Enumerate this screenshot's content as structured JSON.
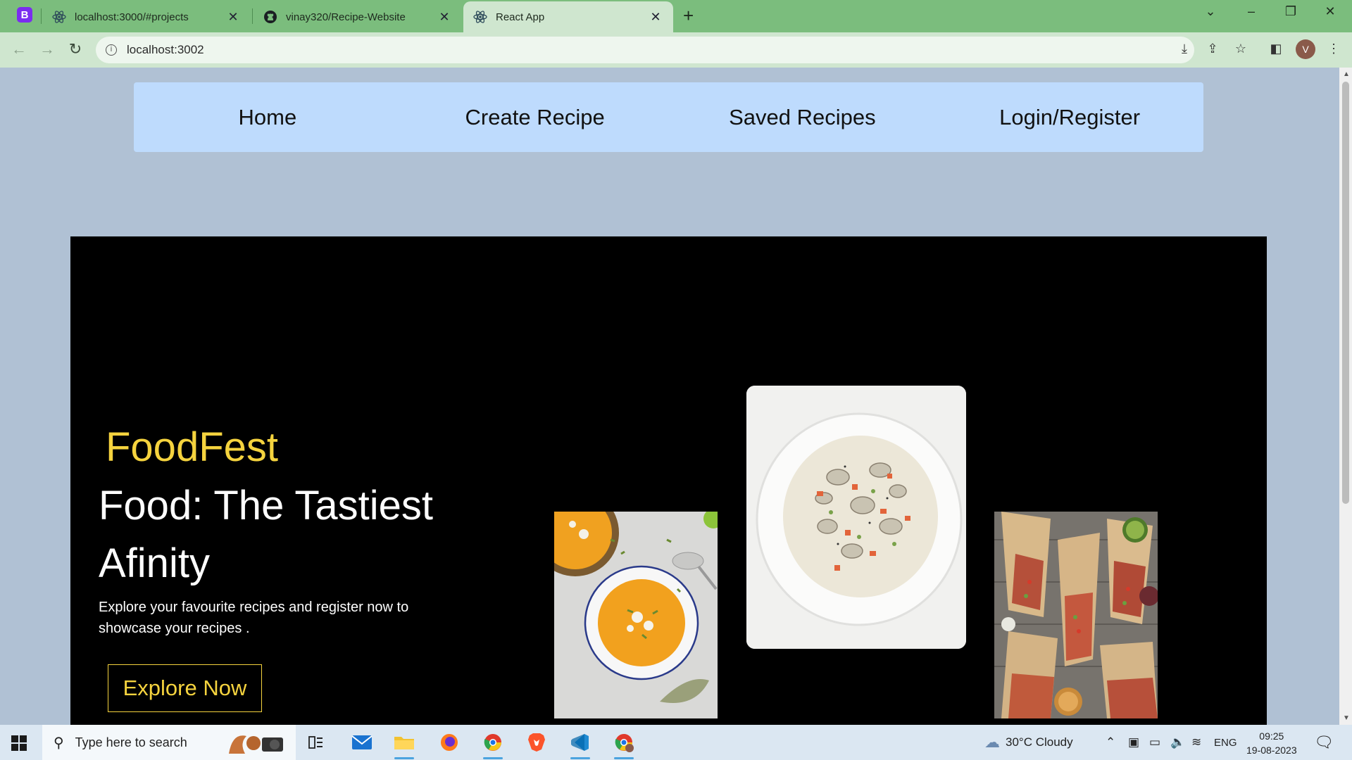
{
  "browser": {
    "tabs": [
      {
        "title": "localhost:3000/#projects",
        "active": false
      },
      {
        "title": "vinay320/Recipe-Website",
        "active": false
      },
      {
        "title": "React App",
        "active": true
      }
    ],
    "url": "localhost:3002",
    "profile_initial": "V",
    "browser_badge": "B"
  },
  "page": {
    "nav": {
      "items": [
        "Home",
        "Create Recipe",
        "Saved Recipes",
        "Login/Register"
      ]
    },
    "hero": {
      "brand": "FoodFest",
      "headline": "Food: The Tastiest Afinity",
      "description": "Explore your favourite recipes and register now to showcase your recipes .",
      "cta_label": "Explore Now"
    },
    "colors": {
      "page_background": "#b0c1d4",
      "navbar_background": "#bedbfd",
      "hero_background": "#000000",
      "accent_yellow": "#f5d33e"
    },
    "images": [
      "pumpkin-soup-photo",
      "clam-chowder-photo",
      "burrito-wraps-photo"
    ]
  },
  "taskbar": {
    "search_placeholder": "Type here to search",
    "weather": "30°C  Cloudy",
    "language": "ENG",
    "time": "09:25",
    "date": "19-08-2023"
  }
}
